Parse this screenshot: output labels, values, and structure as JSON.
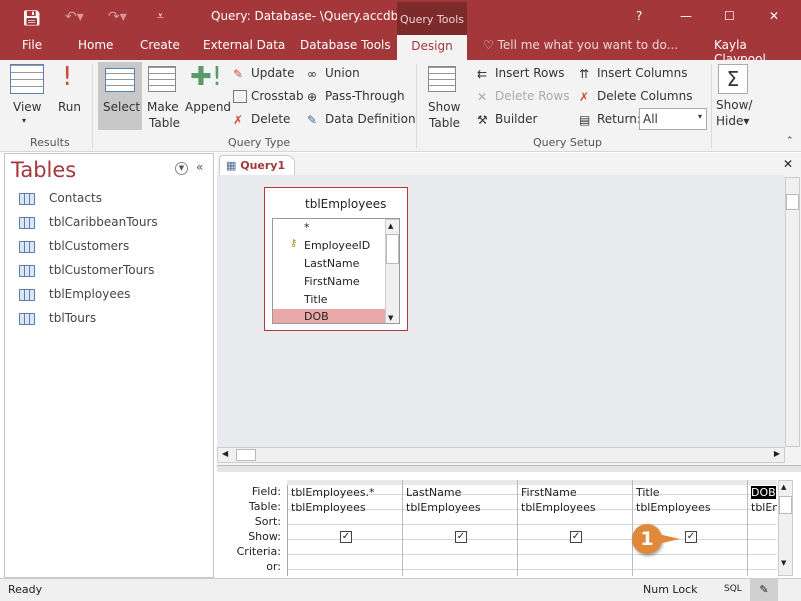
{
  "title_bar": {
    "title": "Query: Database- \\Query.accdb...",
    "context_tab": "Query Tools",
    "help": "?",
    "minimize": "—",
    "maximize": "☐",
    "close": "✕",
    "user": "Kayla Claypool"
  },
  "tabs": [
    "File",
    "Home",
    "Create",
    "External Data",
    "Database Tools",
    "Design"
  ],
  "tell_me": "Tell me what you want to do...",
  "ribbon": {
    "results": {
      "label": "Results",
      "view": "View",
      "run": "Run"
    },
    "query_type": {
      "label": "Query Type",
      "select": "Select",
      "make_table_1": "Make",
      "make_table_2": "Table",
      "append": "Append",
      "update": "Update",
      "crosstab": "Crosstab",
      "delete": "Delete",
      "union": "Union",
      "pass_through": "Pass-Through",
      "data_definition": "Data Definition"
    },
    "query_setup": {
      "label": "Query Setup",
      "show_table_1": "Show",
      "show_table_2": "Table",
      "insert_rows": "Insert Rows",
      "delete_rows": "Delete Rows",
      "builder": "Builder",
      "insert_columns": "Insert Columns",
      "delete_columns": "Delete Columns",
      "return_label": "Return:",
      "return_value": "All"
    },
    "show_hide_1": "Show/",
    "show_hide_2": "Hide"
  },
  "nav": {
    "title": "Tables",
    "items": [
      "Contacts",
      "tblCaribbeanTours",
      "tblCustomers",
      "tblCustomerTours",
      "tblEmployees",
      "tblTours"
    ]
  },
  "doc_tab": "Query1",
  "table_box": {
    "title": "tblEmployees",
    "fields": [
      "*",
      "EmployeeID",
      "LastName",
      "FirstName",
      "Title",
      "DOB"
    ]
  },
  "grid": {
    "row_labels": [
      "Field:",
      "Table:",
      "Sort:",
      "Show:",
      "Criteria:",
      "or:"
    ],
    "columns": [
      {
        "field": "tblEmployees.*",
        "table": "tblEmployees",
        "show": true
      },
      {
        "field": "LastName",
        "table": "tblEmployees",
        "show": true
      },
      {
        "field": "FirstName",
        "table": "tblEmployees",
        "show": true
      },
      {
        "field": "Title",
        "table": "tblEmployees",
        "show": true
      },
      {
        "field": "DOB",
        "table": "tblEm",
        "show": false
      }
    ]
  },
  "callout": "1",
  "status": {
    "left": "Ready",
    "num_lock": "Num Lock",
    "sql": "SQL"
  },
  "colors": {
    "accent": "#a4373a",
    "callout": "#e0893a",
    "selected_field": "#eaa9a9"
  }
}
